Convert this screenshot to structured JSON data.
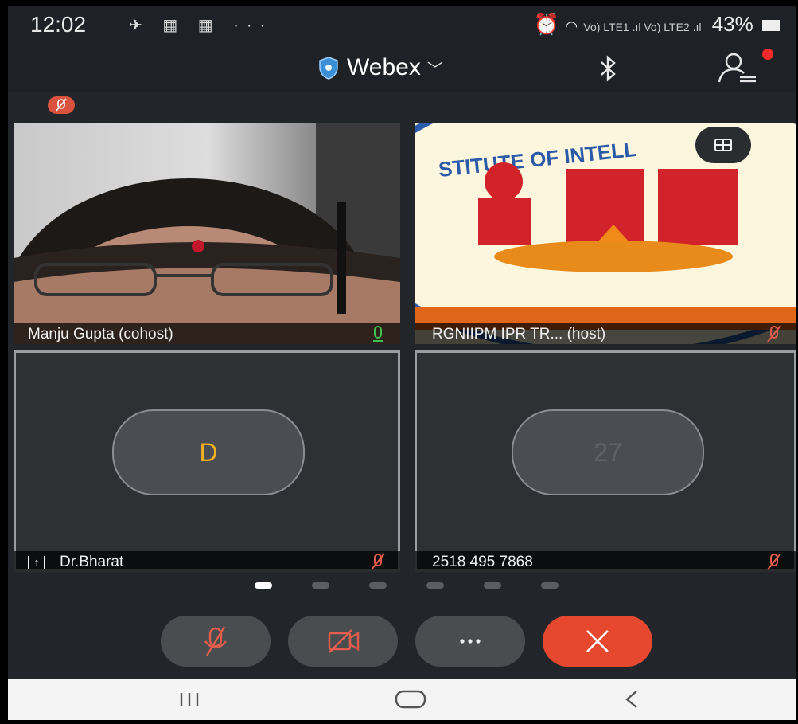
{
  "status_bar": {
    "time": "12:02",
    "network_label": "Vo) LTE1 .ıl Vo) LTE2 .ıl",
    "battery": "43%"
  },
  "header": {
    "app_name": "Webex"
  },
  "tiles": [
    {
      "name": "Manju Gupta (cohost)",
      "mic": "on"
    },
    {
      "name": "RGNIIPM IPR TR... (host)",
      "mic": "muted"
    },
    {
      "name": "Dr.Bharat",
      "mic": "muted",
      "avatar_initial": "D",
      "sharing": true
    },
    {
      "name": "2518 495 7868",
      "mic": "muted",
      "avatar_initial": "27"
    }
  ],
  "pager": {
    "pages": 6,
    "current": 1
  },
  "colors": {
    "accent_blue": "#3b8fd6",
    "end_red": "#e5482f",
    "mute_red": "#e35d4c",
    "mic_green": "#3fbf4f",
    "initial_orange": "#f2b01e"
  }
}
